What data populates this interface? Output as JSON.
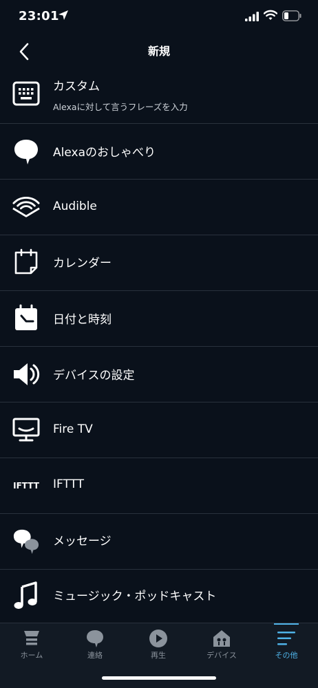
{
  "status_bar": {
    "time": "23:01"
  },
  "nav": {
    "title": "新規"
  },
  "rows": [
    {
      "label": "カスタム",
      "sublabel": "Alexaに対して言うフレーズを入力",
      "icon": "keyboard-icon"
    },
    {
      "label": "Alexaのおしゃべり",
      "icon": "speech-bubble-icon"
    },
    {
      "label": "Audible",
      "icon": "audible-icon"
    },
    {
      "label": "カレンダー",
      "icon": "calendar-icon"
    },
    {
      "label": "日付と時刻",
      "icon": "date-time-icon"
    },
    {
      "label": "デバイスの設定",
      "icon": "speaker-icon"
    },
    {
      "label": "Fire TV",
      "icon": "tv-icon"
    },
    {
      "label": "IFTTT",
      "icon": "ifttt-logo",
      "logo_text": "IFTTT"
    },
    {
      "label": "メッセージ",
      "icon": "messages-icon"
    },
    {
      "label": "ミュージック・ポッドキャスト",
      "icon": "music-note-icon"
    }
  ],
  "tabs": [
    {
      "label": "ホーム",
      "icon": "home-icon",
      "active": false
    },
    {
      "label": "連絡",
      "icon": "communicate-icon",
      "active": false
    },
    {
      "label": "再生",
      "icon": "play-icon",
      "active": false
    },
    {
      "label": "デバイス",
      "icon": "devices-icon",
      "active": false
    },
    {
      "label": "その他",
      "icon": "more-icon",
      "active": true
    }
  ],
  "colors": {
    "background": "#0a111b",
    "tab_bar": "#121a24",
    "divider": "#2a323d",
    "accent": "#4fb3e8",
    "inactive": "#8b939c"
  }
}
